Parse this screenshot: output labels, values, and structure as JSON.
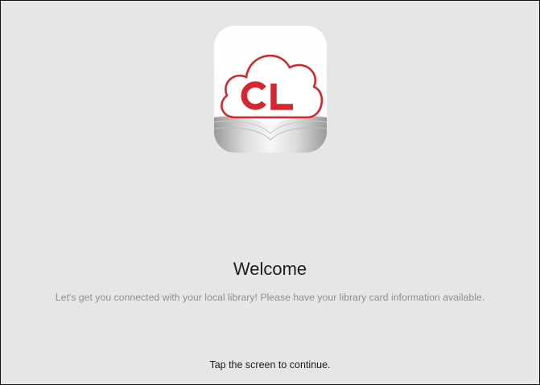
{
  "app_icon": {
    "icon": "cloudlibrary-logo-icon",
    "logo_text": "CL",
    "brand_color": "#d5272f"
  },
  "welcome": {
    "title": "Welcome",
    "message": "Let's get you connected with your local library! Please have your library card information available."
  },
  "continue_hint": "Tap the screen to continue.",
  "colors": {
    "background": "#e6e6e6",
    "title": "#1d1d1d",
    "message": "#8f8f8f"
  }
}
